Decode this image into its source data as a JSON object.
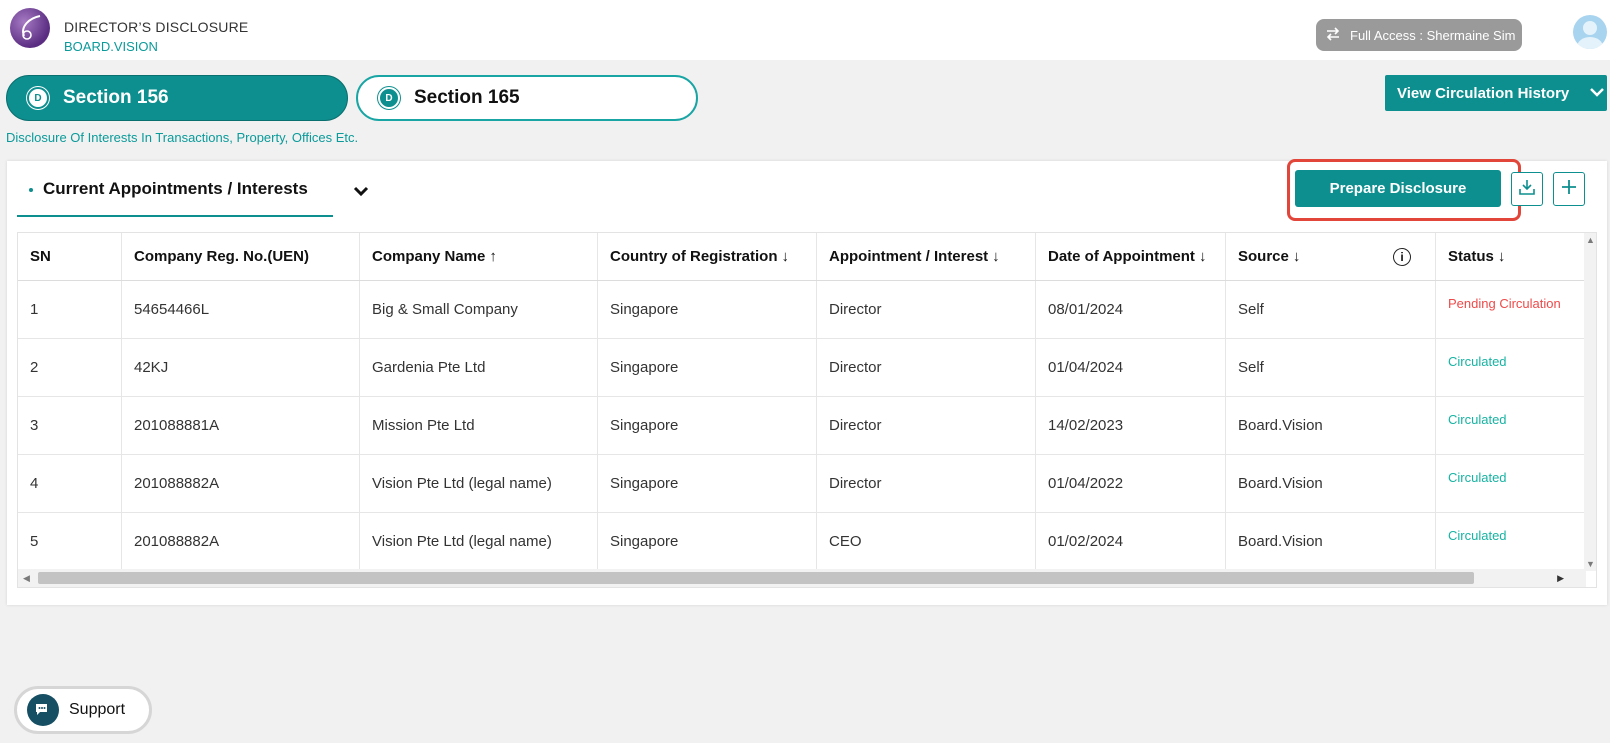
{
  "header": {
    "app_title": "DIRECTOR’S DISCLOSURE",
    "app_subtitle": "BOARD.VISION",
    "access_label": "Full Access : Shermaine Sim"
  },
  "sections": {
    "tabs": [
      {
        "badge": "D",
        "label": "Section 156",
        "active": true
      },
      {
        "badge": "D",
        "label": "Section 165",
        "active": false
      }
    ],
    "description": "Disclosure Of Interests In Transactions, Property, Offices Etc.",
    "view_history_label": "View Circulation History"
  },
  "card": {
    "tab_label": "Current Appointments / Interests",
    "prepare_label": "Prepare Disclosure"
  },
  "table": {
    "headers": [
      {
        "label": "SN",
        "sort": ""
      },
      {
        "label": "Company Reg. No.(UEN)",
        "sort": ""
      },
      {
        "label": "Company Name",
        "sort": "↑"
      },
      {
        "label": "Country of Registration",
        "sort": "↓"
      },
      {
        "label": "Appointment / Interest",
        "sort": "↓"
      },
      {
        "label": "Date of Appointment",
        "sort": "↓"
      },
      {
        "label": "Source",
        "sort": "↓"
      },
      {
        "label": "Status",
        "sort": "↓"
      }
    ],
    "rows": [
      {
        "sn": "1",
        "uen": "54654466L",
        "company": "Big & Small Company",
        "country": "Singapore",
        "appointment": "Director",
        "date": "08/01/2024",
        "source": "Self",
        "status": "Pending Circulation"
      },
      {
        "sn": "2",
        "uen": "42KJ",
        "company": "Gardenia Pte Ltd",
        "country": "Singapore",
        "appointment": "Director",
        "date": "01/04/2024",
        "source": "Self",
        "status": "Circulated"
      },
      {
        "sn": "3",
        "uen": "201088881A",
        "company": "Mission Pte Ltd",
        "country": "Singapore",
        "appointment": "Director",
        "date": "14/02/2023",
        "source": "Board.Vision",
        "status": "Circulated"
      },
      {
        "sn": "4",
        "uen": "201088882A",
        "company": "Vision Pte Ltd (legal name)",
        "country": "Singapore",
        "appointment": "Director",
        "date": "01/04/2022",
        "source": "Board.Vision",
        "status": "Circulated"
      },
      {
        "sn": "5",
        "uen": "201088882A",
        "company": "Vision Pte Ltd (legal name)",
        "country": "Singapore",
        "appointment": "CEO",
        "date": "01/02/2024",
        "source": "Board.Vision",
        "status": "Circulated"
      }
    ]
  },
  "support": {
    "label": "Support"
  },
  "colors": {
    "accent": "#0e8f8f",
    "pending": "#ef4a4a",
    "circulated": "#17b3a3",
    "highlight": "#e2453a"
  },
  "icons": [
    "logo-icon",
    "switch-arrows-icon",
    "avatar-icon",
    "chevron-down-icon",
    "download-icon",
    "plus-icon",
    "info-icon",
    "chat-icon"
  ]
}
